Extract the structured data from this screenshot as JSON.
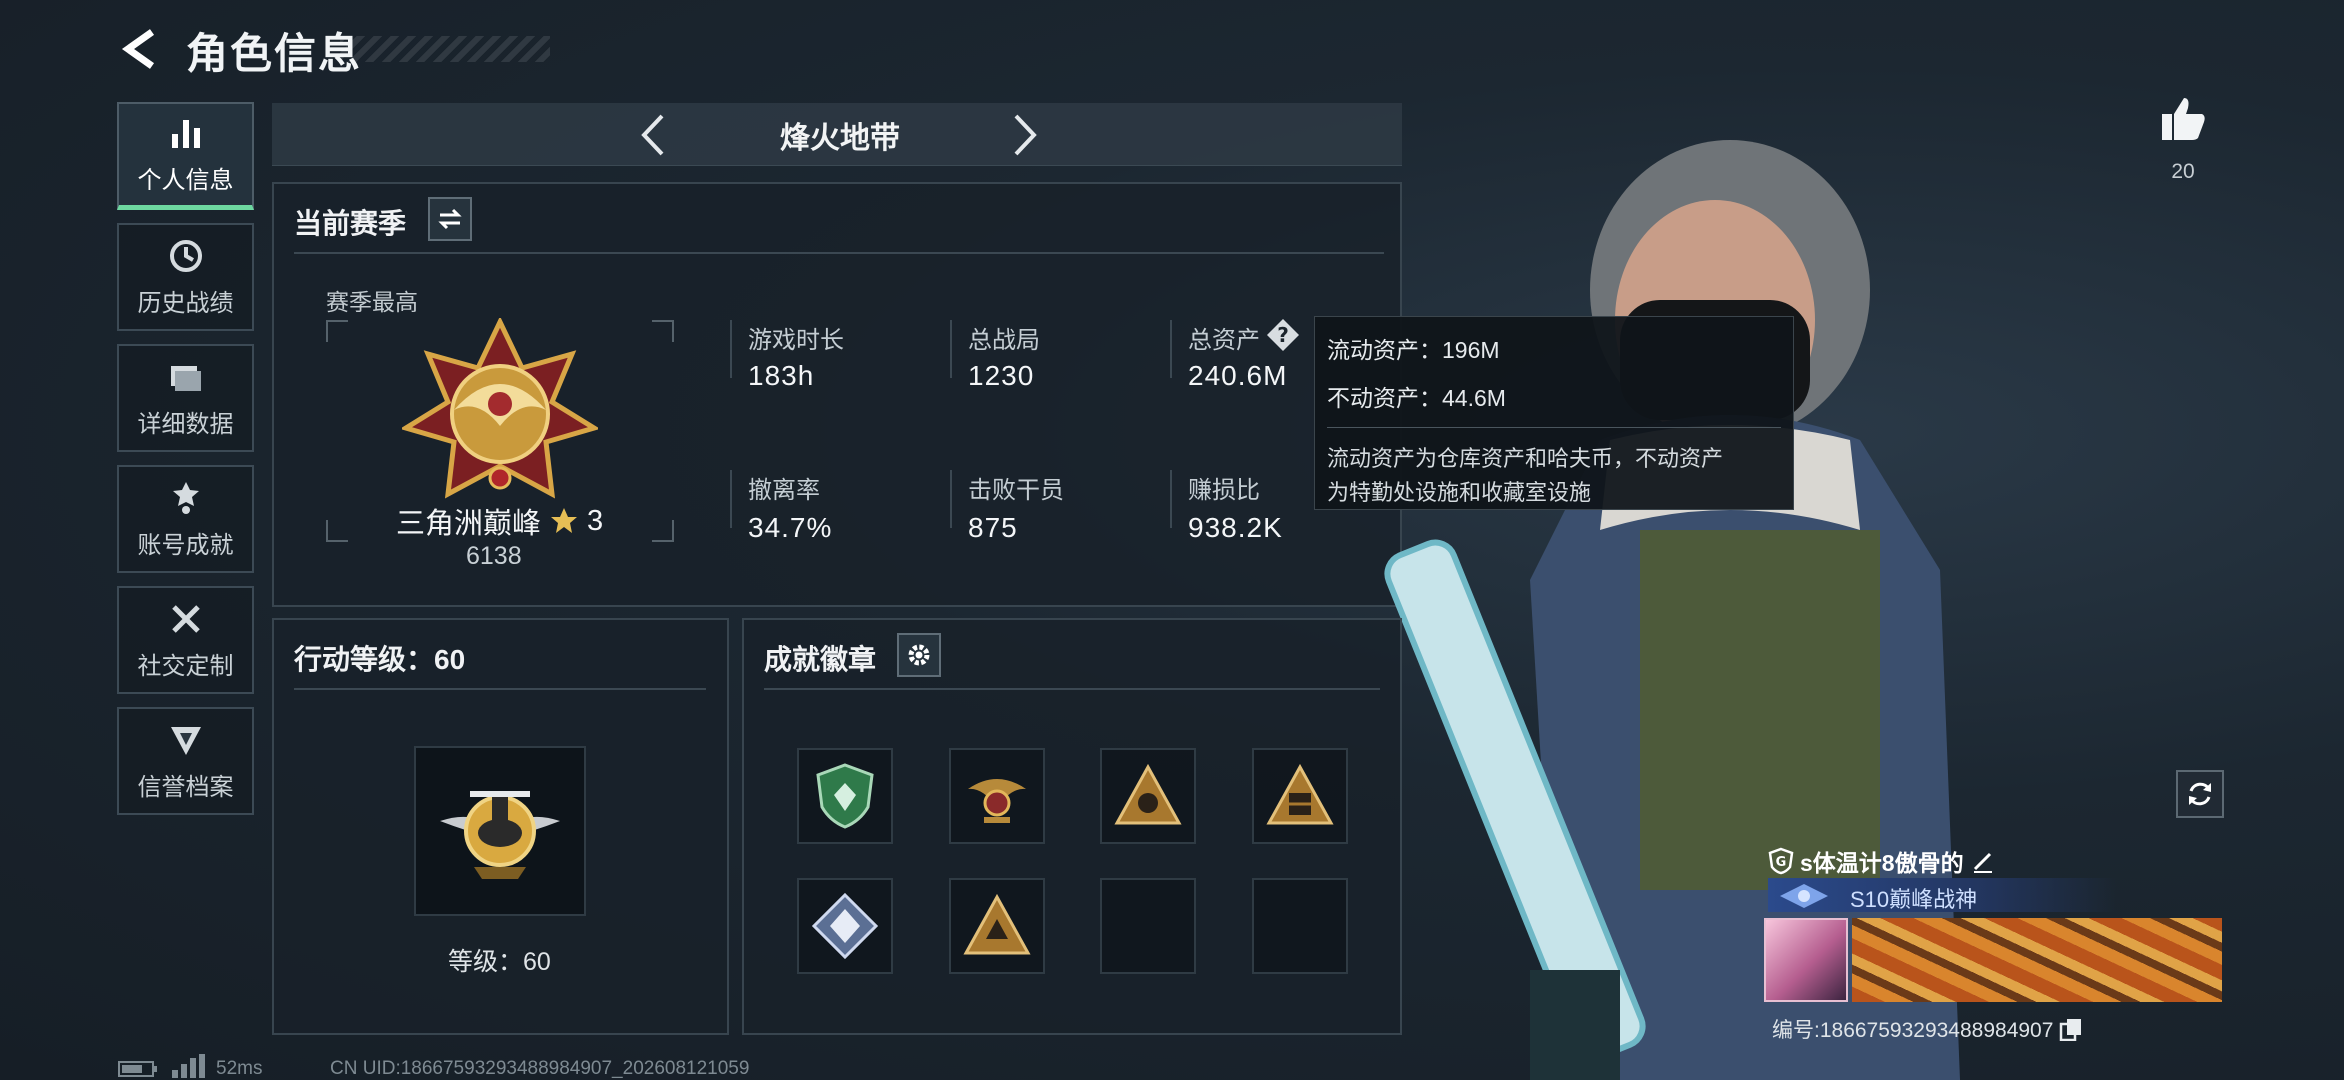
{
  "header": {
    "title": "角色信息"
  },
  "nav": {
    "items": [
      {
        "label": "个人信息",
        "icon": "bar-chart-icon",
        "active": true
      },
      {
        "label": "历史战绩",
        "icon": "history-clock-icon",
        "active": false
      },
      {
        "label": "详细数据",
        "icon": "folder-icon",
        "active": false
      },
      {
        "label": "账号成就",
        "icon": "achievement-medal-icon",
        "active": false
      },
      {
        "label": "社交定制",
        "icon": "tools-icon",
        "active": false
      },
      {
        "label": "信誉档案",
        "icon": "credit-badge-icon",
        "active": false
      }
    ]
  },
  "mode": {
    "name": "烽火地带"
  },
  "season": {
    "title": "当前赛季",
    "best_label": "赛季最高",
    "rank_name": "三角洲巅峰",
    "rank_stars": "3",
    "rank_score": "6138",
    "stats": [
      {
        "label": "游戏时长",
        "value": "183h"
      },
      {
        "label": "总战局",
        "value": "1230"
      },
      {
        "label": "总资产",
        "value": "240.6M"
      },
      {
        "label": "撤离率",
        "value": "34.7%"
      },
      {
        "label": "击败干员",
        "value": "875"
      },
      {
        "label": "赚损比",
        "value": "938.2K"
      }
    ]
  },
  "tooltip": {
    "liquid": "流动资产：196M",
    "fixed": "不动资产：44.6M",
    "desc_line1": "流动资产为仓库资产和哈夫币，不动资产",
    "desc_line2": "为特勤处设施和收藏室设施"
  },
  "action_level": {
    "title": "行动等级：60",
    "level_text": "等级：60"
  },
  "badges": {
    "title": "成就徽章",
    "slots": [
      {
        "icon": "shield-badge-icon",
        "color": "#2f7a4a"
      },
      {
        "icon": "eagle-badge-icon",
        "color": "#b78a3a"
      },
      {
        "icon": "triangle-badge-icon",
        "color": "#a8782e"
      },
      {
        "icon": "triangle-crate-badge-icon",
        "color": "#a8782e"
      },
      {
        "icon": "diamond-badge-icon",
        "color": "#8fa3c9"
      },
      {
        "icon": "triangle-tech-badge-icon",
        "color": "#a8782e"
      },
      {
        "icon": "empty-slot",
        "color": ""
      },
      {
        "icon": "empty-slot",
        "color": ""
      }
    ]
  },
  "like": {
    "count": "20"
  },
  "player": {
    "name": "s体温计8傲骨的",
    "title": "S10巅峰战神",
    "id_text": "编号:18667593293488984907"
  },
  "footer": {
    "ping": "52ms",
    "uid": "CN UID:18667593293488984907_202608121059"
  },
  "colors": {
    "accent": "#6dd8a0",
    "gold": "#d2a03a"
  }
}
